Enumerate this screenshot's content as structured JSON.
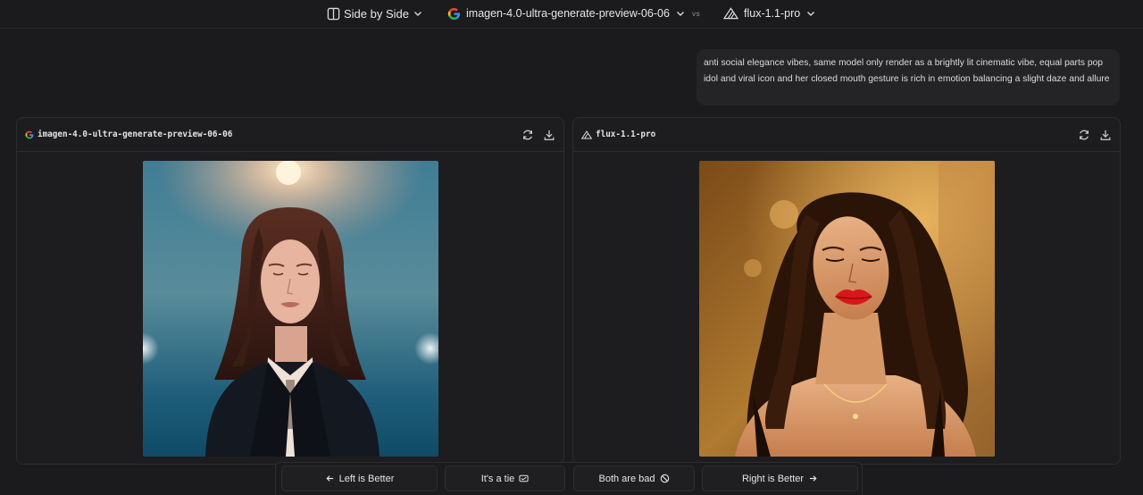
{
  "header": {
    "mode_label": "Side by Side",
    "model_a": "imagen-4.0-ultra-generate-preview-06-06",
    "vs_label": "vs",
    "model_b": "flux-1.1-pro"
  },
  "prompt": {
    "text": "anti social elegance vibes, same model only render as a brightly lit cinematic vibe, equal parts pop idol and viral icon and her closed mouth gesture is rich in emotion balancing a slight daze and allure"
  },
  "panels": {
    "left": {
      "title": "imagen-4.0-ultra-generate-preview-06-06",
      "icon": "google-icon"
    },
    "right": {
      "title": "flux-1.1-pro",
      "icon": "flux-icon"
    }
  },
  "votes": {
    "left_better": "Left is Better",
    "tie": "It's a tie",
    "both_bad": "Both are bad",
    "right_better": "Right is Better"
  },
  "colors": {
    "background": "#1b1b1d",
    "panel": "#1d1d20",
    "border": "#2d2d31",
    "lips_red": "#d9161a"
  }
}
